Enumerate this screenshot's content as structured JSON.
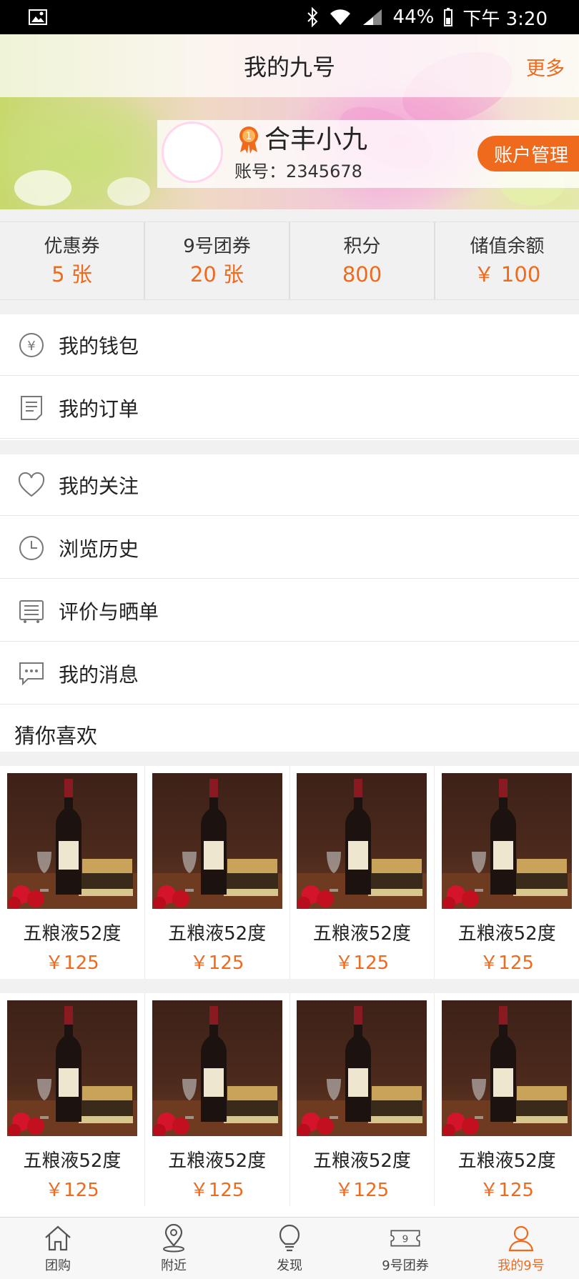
{
  "status_bar": {
    "battery": "44%",
    "time": "下午 3:20"
  },
  "header": {
    "title": "我的九号",
    "more": "更多"
  },
  "profile": {
    "name": "合丰小九",
    "account": "账号：2345678",
    "level": "1",
    "manage_button": "账户管理"
  },
  "stats": [
    {
      "label": "优惠券",
      "value": "5 张"
    },
    {
      "label": "9号团券",
      "value": "20 张"
    },
    {
      "label": "积分",
      "value": "800"
    },
    {
      "label": "储值余额",
      "value": "￥ 100"
    }
  ],
  "menu": {
    "wallet": "我的钱包",
    "orders": "我的订单",
    "favorites": "我的关注",
    "history": "浏览历史",
    "reviews": "评价与晒单",
    "messages": "我的消息"
  },
  "recommend": {
    "title": "猜你喜欢",
    "products": [
      {
        "name": "五粮液52度",
        "price": "￥125"
      },
      {
        "name": "五粮液52度",
        "price": "￥125"
      },
      {
        "name": "五粮液52度",
        "price": "￥125"
      },
      {
        "name": "五粮液52度",
        "price": "￥125"
      },
      {
        "name": "五粮液52度",
        "price": "￥125"
      },
      {
        "name": "五粮液52度",
        "price": "￥125"
      },
      {
        "name": "五粮液52度",
        "price": "￥125"
      },
      {
        "name": "五粮液52度",
        "price": "￥125"
      }
    ]
  },
  "tabs": [
    {
      "label": "团购",
      "icon": "home-icon"
    },
    {
      "label": "附近",
      "icon": "location-pin-icon"
    },
    {
      "label": "发现",
      "icon": "lightbulb-icon"
    },
    {
      "label": "9号团券",
      "icon": "ticket-icon"
    },
    {
      "label": "我的9号",
      "icon": "person-icon"
    }
  ],
  "colors": {
    "accent": "#f06a1d",
    "background": "#f1f1f1"
  }
}
